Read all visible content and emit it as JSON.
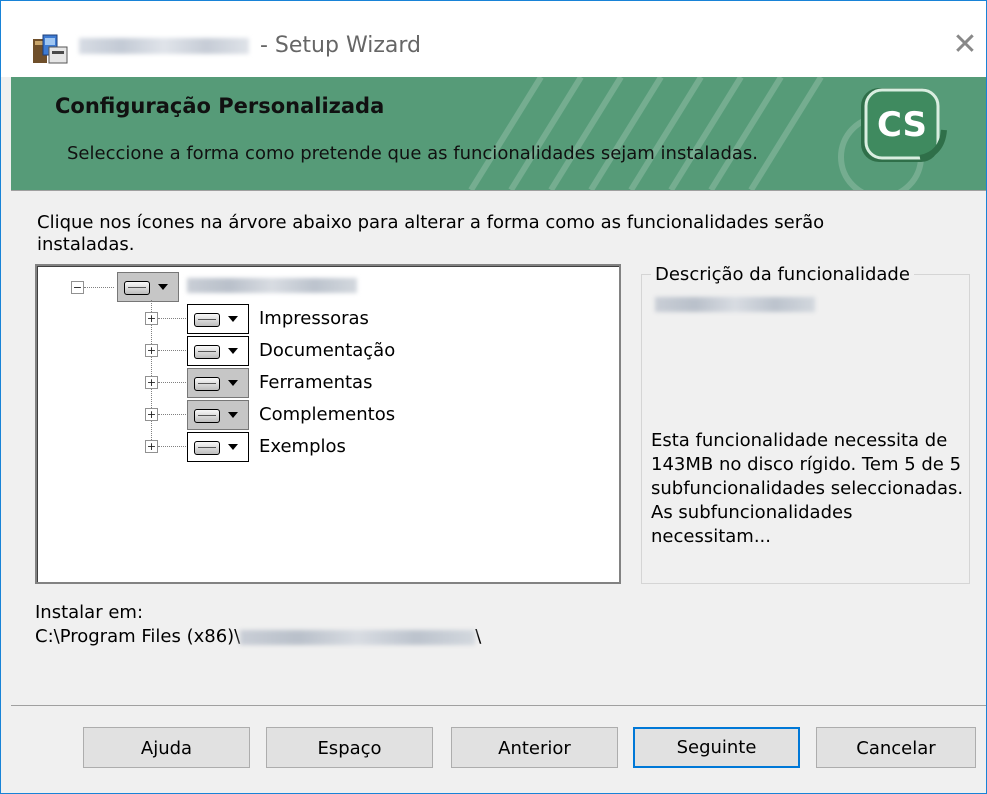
{
  "window": {
    "title_suffix": " - Setup Wizard",
    "close_glyph": "✕"
  },
  "banner": {
    "heading": "Configuração Personalizada",
    "subtitle": "Seleccione a forma como pretende que as funcionalidades sejam instaladas.",
    "logo_text": "CS",
    "colors": {
      "background": "#569b78",
      "logo": "#3f8a5f"
    }
  },
  "instructions": "Clique nos ícones na árvore abaixo para alterar a forma como as funcionalidades serão instaladas.",
  "tree": {
    "root": {
      "expander": "−",
      "icon": "drive-icon",
      "label": ""
    },
    "children": [
      {
        "label": "Impressoras",
        "expander": "+",
        "selected": false
      },
      {
        "label": "Documentação",
        "expander": "+",
        "selected": false
      },
      {
        "label": "Ferramentas",
        "expander": "+",
        "selected": true
      },
      {
        "label": "Complementos",
        "expander": "+",
        "selected": true
      },
      {
        "label": "Exemplos",
        "expander": "+",
        "selected": false
      }
    ]
  },
  "description": {
    "legend": "Descrição da funcionalidade",
    "text": "Esta funcionalidade necessita de 143MB no disco rígido. Tem 5 de 5 subfuncionalidades seleccionadas. As subfuncionalidades necessitam..."
  },
  "install": {
    "label": "Instalar em:",
    "path_prefix": "C:\\Program Files (x86)\\",
    "path_suffix": "\\"
  },
  "buttons": {
    "help": "Ajuda",
    "space": "Espaço",
    "back": "Anterior",
    "next": "Seguinte",
    "cancel": "Cancelar"
  }
}
